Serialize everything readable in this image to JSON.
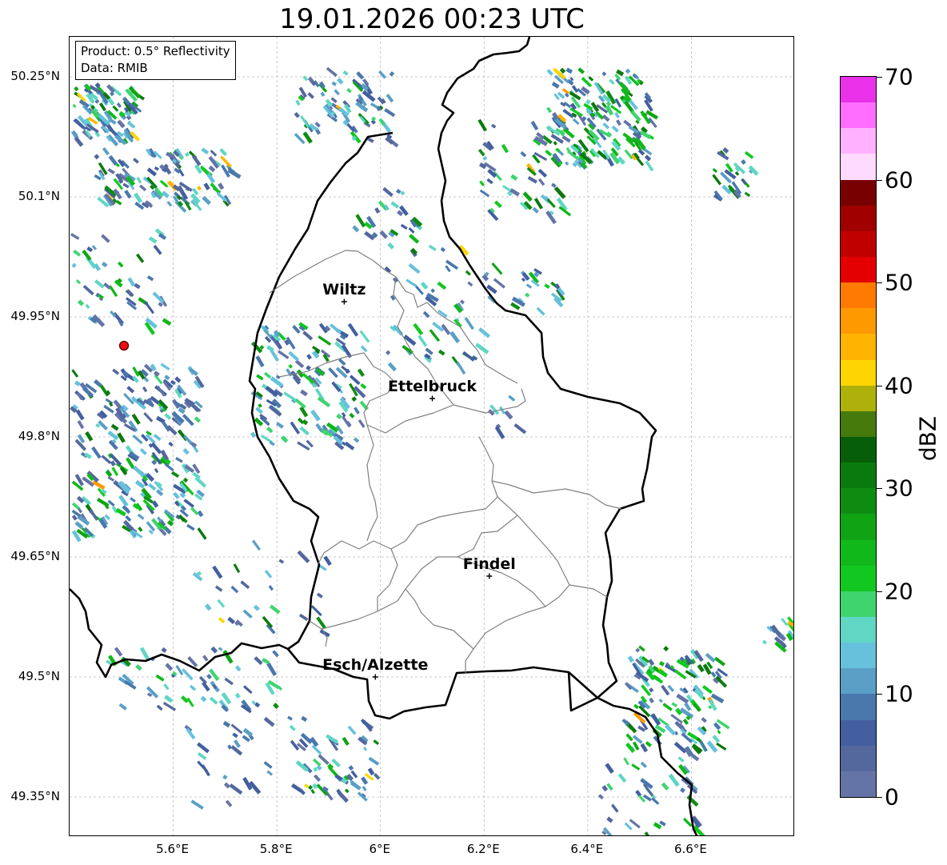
{
  "title": "19.01.2026 00:23 UTC",
  "info_box": {
    "product": "Product: 0.5° Reflectivity",
    "data_source": "Data: RMIB"
  },
  "lat_labels": [
    {
      "text": "50.25°N",
      "lat": 50.25
    },
    {
      "text": "50.1°N",
      "lat": 50.1
    },
    {
      "text": "49.95°N",
      "lat": 49.95
    },
    {
      "text": "49.8°N",
      "lat": 49.8
    },
    {
      "text": "49.65°N",
      "lat": 49.65
    },
    {
      "text": "49.5°N",
      "lat": 49.5
    },
    {
      "text": "49.35°N",
      "lat": 49.35
    }
  ],
  "lon_labels": [
    {
      "text": "5.6°E",
      "lon": 5.6
    },
    {
      "text": "5.8°E",
      "lon": 5.8
    },
    {
      "text": "6°E",
      "lon": 6.0
    },
    {
      "text": "6.2°E",
      "lon": 6.2
    },
    {
      "text": "6.4°E",
      "lon": 6.4
    },
    {
      "text": "6.6°E",
      "lon": 6.6
    }
  ],
  "cities": [
    {
      "name": "Wiltz",
      "lon": 5.93,
      "lat": 49.969
    },
    {
      "name": "Ettelbruck",
      "lon": 6.1,
      "lat": 49.848
    },
    {
      "name": "Findel",
      "lon": 6.21,
      "lat": 49.626
    },
    {
      "name": "Esch/Alzette",
      "lon": 5.99,
      "lat": 49.5
    }
  ],
  "radar_site": {
    "name": "radar-site",
    "lon": 5.505,
    "lat": 49.914
  },
  "colorbar": {
    "label": "dBZ",
    "min": 0,
    "max": 70,
    "ticks": [
      "0",
      "10",
      "20",
      "30",
      "40",
      "50",
      "60",
      "70"
    ],
    "colors": [
      "#6474a6",
      "#54689e",
      "#435f9f",
      "#4a78ad",
      "#5a9fc6",
      "#66c1dc",
      "#60d6c4",
      "#3fd46e",
      "#12c820",
      "#10b81a",
      "#10a415",
      "#0e8c12",
      "#0b7a0e",
      "#075e09",
      "#467a0c",
      "#aeb10a",
      "#ffd500",
      "#ffb400",
      "#ff9900",
      "#ff7a00",
      "#e40000",
      "#c00000",
      "#a00000",
      "#780000",
      "#ffdaff",
      "#ffb2ff",
      "#ff6eff",
      "#ea32ea"
    ]
  },
  "map": {
    "lon_range": [
      5.4,
      6.8
    ],
    "lat_range": [
      49.3,
      50.3
    ],
    "border_color": "#000000",
    "canton_color": "#808080",
    "grid_color": "#bbbbbb"
  }
}
